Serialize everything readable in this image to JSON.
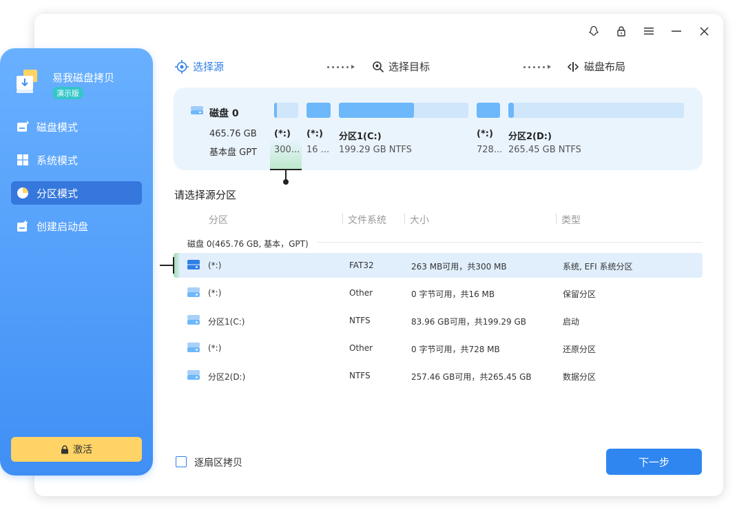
{
  "app": {
    "name": "易我磁盘拷贝",
    "badge": "演示版"
  },
  "sidebar": {
    "items": [
      {
        "label": "磁盘模式",
        "icon": "disk-mode-icon",
        "active": false
      },
      {
        "label": "系统模式",
        "icon": "windows-icon",
        "active": false
      },
      {
        "label": "分区模式",
        "icon": "pie-chart-icon",
        "active": true
      },
      {
        "label": "创建启动盘",
        "icon": "boot-disk-icon",
        "active": false
      }
    ],
    "activate_label": "激活"
  },
  "steps": [
    {
      "label": "选择源",
      "active": true
    },
    {
      "label": "选择目标",
      "active": false
    },
    {
      "label": "磁盘布局",
      "active": false
    }
  ],
  "disk": {
    "name": "磁盘 0",
    "size": "465.76 GB",
    "type": "基本盘 GPT",
    "partitions": [
      {
        "label": "(*:)",
        "info": "300...",
        "used_fraction": 0.12
      },
      {
        "label": "(*:)",
        "info": "16 ...",
        "used_fraction": 1.0
      },
      {
        "label": "分区1(C:)",
        "info": "199.29 GB NTFS",
        "used_fraction": 0.58
      },
      {
        "label": "(*:)",
        "info": "728...",
        "used_fraction": 1.0
      },
      {
        "label": "分区2(D:)",
        "info": "265.45 GB NTFS",
        "used_fraction": 0.03
      }
    ]
  },
  "list": {
    "title": "请选择源分区",
    "columns": [
      "分区",
      "文件系统",
      "大小",
      "类型"
    ],
    "group": "磁盘 0(465.76 GB, 基本，GPT)",
    "rows": [
      {
        "name": "(*:)",
        "fs": "FAT32",
        "size": "263 MB可用，共300 MB",
        "type": "系统, EFI 系统分区",
        "selected": true
      },
      {
        "name": "(*:)",
        "fs": "Other",
        "size": "0 字节可用，共16 MB",
        "type": "保留分区",
        "selected": false
      },
      {
        "name": "分区1(C:)",
        "fs": "NTFS",
        "size": "83.96 GB可用，共199.29 GB",
        "type": "启动",
        "selected": false
      },
      {
        "name": "(*:)",
        "fs": "Other",
        "size": "0 字节可用，共728 MB",
        "type": "还原分区",
        "selected": false
      },
      {
        "name": "分区2(D:)",
        "fs": "NTFS",
        "size": "257.46 GB可用，共265.45 GB",
        "type": "数据分区",
        "selected": false
      }
    ]
  },
  "footer": {
    "sector_copy_label": "逐扇区拷贝",
    "next_label": "下一步"
  },
  "colors": {
    "accent": "#2f86f0",
    "sidebar_top": "#69b0ff",
    "sidebar_bottom": "#3f8ff5",
    "activate": "#ffd366"
  }
}
